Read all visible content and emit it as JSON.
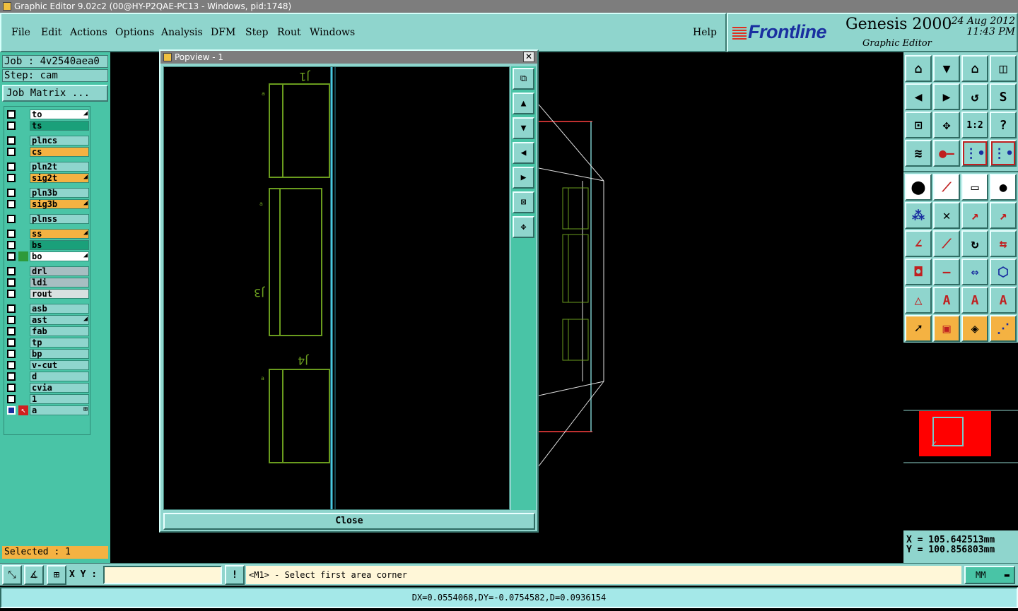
{
  "window": {
    "title": "Graphic Editor 9.02c2 (00@HY-P2QAE-PC13 - Windows, pid:1748)"
  },
  "menu": {
    "items": [
      "File",
      "Edit",
      "Actions",
      "Options",
      "Analysis",
      "DFM",
      "Step",
      "Rout",
      "Windows"
    ],
    "help": "Help"
  },
  "brand": {
    "logo": "Frontline",
    "product": "Genesis 2000",
    "subtitle": "Graphic Editor",
    "date": "24 Aug 2012",
    "time": "11:43 PM"
  },
  "job": {
    "job_label": "Job : 4v2540aea0",
    "step_label": "Step: cam",
    "matrix_button": "Job Matrix ..."
  },
  "layers": [
    {
      "name": "to",
      "color": "#ffffff",
      "mark": "◢"
    },
    {
      "name": "ts",
      "color": "#1aa07a",
      "mark": ""
    },
    {
      "name": "plncs",
      "color": "#8fd5cd",
      "mark": ""
    },
    {
      "name": "cs",
      "color": "#f4b242",
      "mark": ""
    },
    {
      "name": "pln2t",
      "color": "#8fd5cd",
      "mark": ""
    },
    {
      "name": "sig2t",
      "color": "#f4b242",
      "mark": "◢"
    },
    {
      "name": "pln3b",
      "color": "#8fd5cd",
      "mark": ""
    },
    {
      "name": "sig3b",
      "color": "#f4b242",
      "mark": "◢"
    },
    {
      "name": "plnss",
      "color": "#8fd5cd",
      "mark": ""
    },
    {
      "name": "ss",
      "color": "#f4b242",
      "mark": "◢"
    },
    {
      "name": "bs",
      "color": "#1aa07a",
      "mark": ""
    },
    {
      "name": "bo",
      "color": "#ffffff",
      "mark": "◢"
    },
    {
      "name": "drl",
      "color": "#a7bec2",
      "mark": ""
    },
    {
      "name": "ldi",
      "color": "#a7bec2",
      "mark": ""
    },
    {
      "name": "rout",
      "color": "#d8e0e0",
      "mark": ""
    },
    {
      "name": "asb",
      "color": "#8fd5cd",
      "mark": ""
    },
    {
      "name": "ast",
      "color": "#8fd5cd",
      "mark": "◢"
    },
    {
      "name": "fab",
      "color": "#8fd5cd",
      "mark": ""
    },
    {
      "name": "tp",
      "color": "#8fd5cd",
      "mark": ""
    },
    {
      "name": "bp",
      "color": "#8fd5cd",
      "mark": ""
    },
    {
      "name": "v-cut",
      "color": "#8fd5cd",
      "mark": ""
    },
    {
      "name": "d",
      "color": "#8fd5cd",
      "mark": ""
    },
    {
      "name": "cvia",
      "color": "#8fd5cd",
      "mark": ""
    },
    {
      "name": "1",
      "color": "#8fd5cd",
      "mark": ""
    },
    {
      "name": "a",
      "color": "#8fd5cd",
      "mark": "⊞"
    }
  ],
  "selected": "Selected : 1",
  "popup": {
    "title": "Popview - 1",
    "close_x": "✕",
    "close_button": "Close"
  },
  "pcb_labels": {
    "j1": "J1",
    "j3": "J3",
    "j4": "J4"
  },
  "coords": {
    "x": "X  =  105.642513mm",
    "y": "Y  =  100.856803mm"
  },
  "bottom": {
    "xy_label": "X Y :",
    "xy_value": "",
    "warn": "!",
    "prompt": "<M1> - Select first area corner",
    "units": "MM"
  },
  "status": "DX=0.0554068,DY=-0.0754582,D=0.0936154",
  "colors": {
    "panel": "#8fd5cd",
    "panel_dark": "#49c4a6",
    "accent": "#f4b242",
    "title_bar": "#7d7d7d",
    "trace_green": "#6a9c1e"
  }
}
